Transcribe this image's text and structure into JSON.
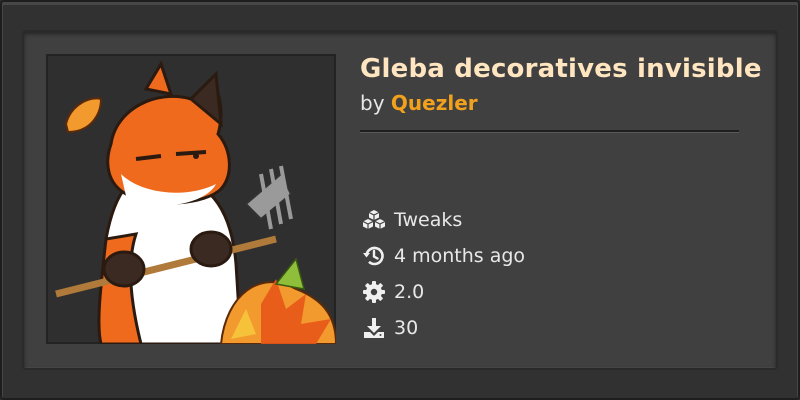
{
  "mod": {
    "title": "Gleba decoratives invisible",
    "by_label": "by",
    "author": "Quezler",
    "thumbnail_icon": "fox-with-rake-icon"
  },
  "meta": [
    {
      "icon": "cubes-icon",
      "text": "Tweaks"
    },
    {
      "icon": "history-icon",
      "text": "4 months ago"
    },
    {
      "icon": "gear-icon",
      "text": "2.0"
    },
    {
      "icon": "download-icon",
      "text": "30"
    }
  ],
  "colors": {
    "title": "#ffe6c0",
    "author": "#f2a11d",
    "text": "#e8e8e8",
    "card_bg": "#414040"
  }
}
